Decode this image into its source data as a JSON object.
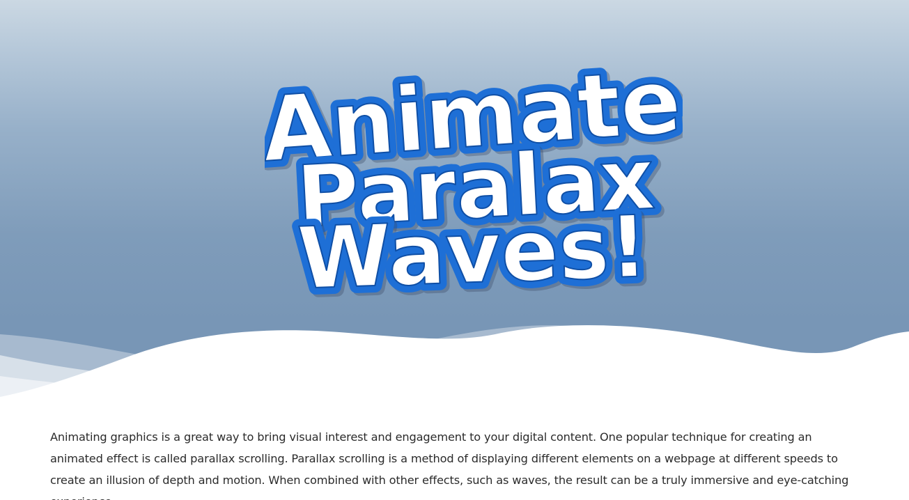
{
  "hero": {
    "title_line1": "Animate",
    "title_line2": "Paralax",
    "title_line3": "Waves!"
  },
  "colors": {
    "sky_top": "#cbd8e3",
    "sky_bottom": "#7896b6",
    "title_fill": "#ffffff",
    "title_stroke": "#1e6fd6",
    "wave_front": "#ffffff"
  },
  "article": {
    "paragraph": "Animating graphics is a great way to bring visual interest and engagement to your digital content. One popular technique for creating an animated effect is called parallax scrolling. Parallax scrolling is a method of displaying different elements on a webpage at different speeds to create an illusion of depth and motion. When combined with other effects, such as waves, the result can be a truly immersive and eye-catching experience."
  }
}
